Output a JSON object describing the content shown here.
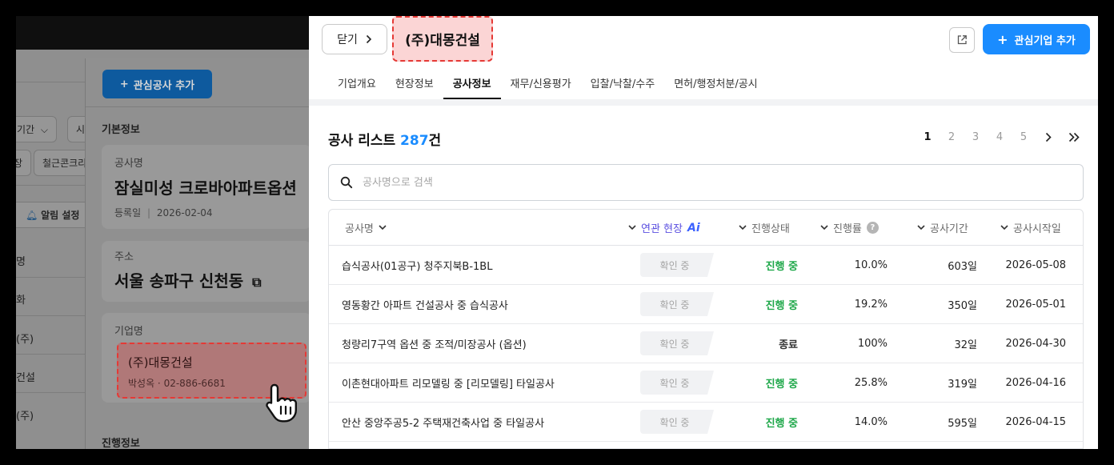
{
  "background": {
    "filters": {
      "period_label": "기간",
      "period_partial": "시",
      "chip_partial": "장",
      "chip_material": "철근콘크리"
    },
    "alert_label": "알림 설정",
    "side_list": [
      "명",
      "화",
      "(주)",
      "건설",
      "(주)"
    ],
    "panel": {
      "add_work_label": "관심공사 추가",
      "basic_info_label": "기본정보",
      "work_name_label": "공사명",
      "work_name_value": "잠실미성 크로바아파트옵션",
      "reg_date_label": "등록일",
      "reg_date_value": "2026-02-04",
      "address_label": "주소",
      "address_value": "서울 송파구 신천동",
      "company_label": "기업명",
      "company_value": "(주)대몽건설",
      "company_contact": "박성옥 · 02-886-6681",
      "progress_info_label": "진행정보"
    }
  },
  "drawer": {
    "close_label": "닫기",
    "company_title": "(주)대몽건설",
    "fav_button_label": "관심기업 추가",
    "tabs": [
      {
        "label": "기업개요",
        "active": false
      },
      {
        "label": "현장정보",
        "active": false
      },
      {
        "label": "공사정보",
        "active": true
      },
      {
        "label": "재무/신용평가",
        "active": false
      },
      {
        "label": "입찰/낙찰/수주",
        "active": false
      },
      {
        "label": "면허/행정처분/공시",
        "active": false
      }
    ],
    "list_title": "공사 리스트",
    "list_count": "287",
    "list_count_unit": "건",
    "pagination": {
      "pages": [
        "1",
        "2",
        "3",
        "4",
        "5"
      ],
      "current": "1"
    },
    "search_placeholder": "공사명으로 검색",
    "columns": {
      "name": "공사명",
      "related_site": "연관 현장",
      "ai": "Ai",
      "status": "진행상태",
      "progress": "진행률",
      "help": "?",
      "period": "공사기간",
      "start_date": "공사시작일"
    },
    "rows": [
      {
        "name": "습식공사(01공구) 청주지북B-1BL",
        "site_status": "확인 중",
        "status": "진행 중",
        "status_type": "active",
        "progress": "10.0%",
        "period": "603일",
        "start": "2026-05-08"
      },
      {
        "name": "영동황간 아파트 건설공사 중 습식공사",
        "site_status": "확인 중",
        "status": "진행 중",
        "status_type": "active",
        "progress": "19.2%",
        "period": "350일",
        "start": "2026-05-01"
      },
      {
        "name": "청량리7구역 옵션 중 조적/미장공사 (옵션)",
        "site_status": "확인 중",
        "status": "종료",
        "status_type": "done",
        "progress": "100%",
        "period": "32일",
        "start": "2026-04-30"
      },
      {
        "name": "이촌현대아파트 리모델링 중 [리모델링] 타일공사",
        "site_status": "확인 중",
        "status": "진행 중",
        "status_type": "active",
        "progress": "25.8%",
        "period": "319일",
        "start": "2026-04-16"
      },
      {
        "name": "안산 중앙주공5-2 주택재건축사업 중 타일공사",
        "site_status": "확인 중",
        "status": "진행 중",
        "status_type": "active",
        "progress": "14.0%",
        "period": "595일",
        "start": "2026-04-15"
      }
    ],
    "colors": {
      "accent": "#1a8cff",
      "active_status": "#1fa84a",
      "ai_label": "#5b4fe0",
      "highlight": "#e53935"
    }
  }
}
